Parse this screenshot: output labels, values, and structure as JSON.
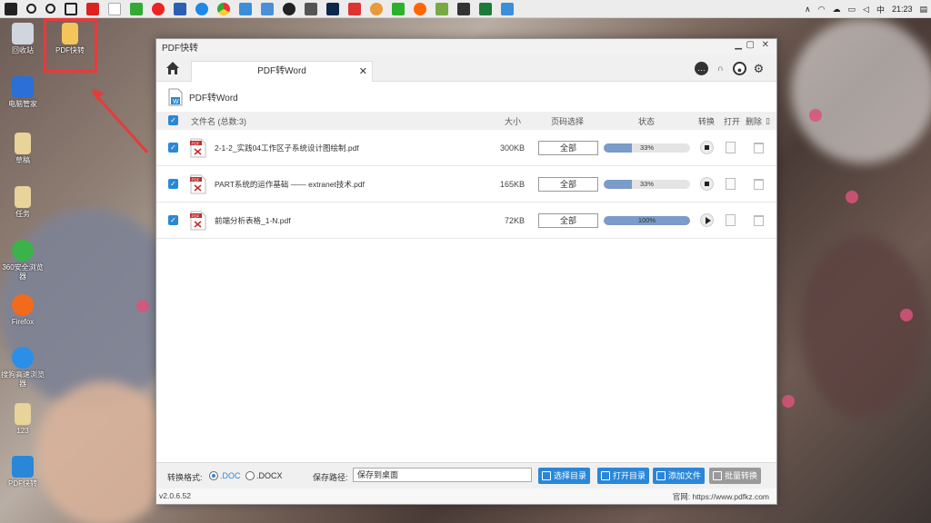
{
  "desktop": {
    "icons": [
      {
        "label": "回收站"
      },
      {
        "label": "PDF快转"
      },
      {
        "label": "电脑管家"
      },
      {
        "label": "草稿"
      },
      {
        "label": "任务"
      },
      {
        "label": "360安全浏览器"
      },
      {
        "label": "Firefox"
      },
      {
        "label": "搜狗高速浏览器"
      },
      {
        "label": "123"
      },
      {
        "label": "PDF快转"
      }
    ]
  },
  "taskbar": {
    "ime": "中",
    "time": "21:23",
    "app_icons": [
      "start-icon",
      "search-icon",
      "cortana-icon",
      "taskview-icon",
      "browser-icon",
      "file-icon",
      "game-icon",
      "weibo-icon",
      "word-icon",
      "edge-icon",
      "chrome-icon",
      "baidu-icon",
      "tool-icon",
      "qq-icon",
      "taskmgr-icon",
      "photoshop-icon",
      "app-icon",
      "face-icon",
      "wechat-icon",
      "firefox-icon",
      "app2-icon",
      "vpn-icon",
      "excel-icon",
      "cloud-icon"
    ]
  },
  "window": {
    "title": "PDF快转",
    "tab_label": "PDF转Word",
    "page_title": "PDF转Word",
    "columns": {
      "filename": "文件名 (总数:3)",
      "size": "大小",
      "pages": "页码选择",
      "status": "状态",
      "convert": "转换",
      "open": "打开",
      "delete": "删除"
    },
    "files": [
      {
        "name": "2-1-2_实践04工作区子系统设计图绘制.pdf",
        "size": "300KB",
        "pages": "全部",
        "progress": 33,
        "progress_text": "33%",
        "action": "stop"
      },
      {
        "name": "PART系统的运作基础 —— extranet技术.pdf",
        "size": "165KB",
        "pages": "全部",
        "progress": 33,
        "progress_text": "33%",
        "action": "stop"
      },
      {
        "name": "前端分析表格_1-N.pdf",
        "size": "72KB",
        "pages": "全部",
        "progress": 100,
        "progress_text": "100%",
        "action": "play"
      }
    ],
    "footer": {
      "format_label": "转换格式:",
      "opt_doc": ".DOC",
      "opt_docx": ".DOCX",
      "selected": ".DOC",
      "save_label": "保存路径:",
      "save_value": "保存到桌面",
      "btn_select_dir": "选择目录",
      "btn_open_dir": "打开目录",
      "btn_add_file": "添加文件",
      "btn_batch": "批量转换"
    },
    "version": "v2.0.6.52",
    "website": "官网: https://www.pdfkz.com"
  },
  "colors": {
    "accent": "#2a87d8",
    "progress": "#7b9bc8",
    "highlight": "#e63b3b"
  }
}
